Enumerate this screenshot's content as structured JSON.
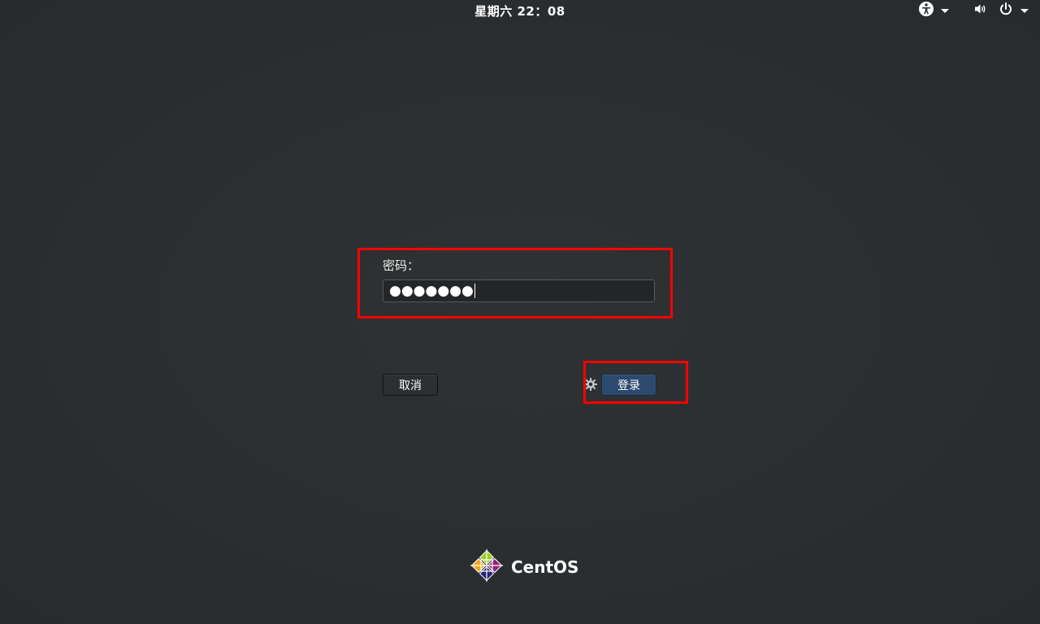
{
  "topbar": {
    "clock": "星期六  22：08",
    "accessibility_icon": "accessibility-icon",
    "volume_icon": "volume-icon",
    "power_icon": "power-icon"
  },
  "auth": {
    "prompt_label": "密码：",
    "password_mask": "●●●●●●●",
    "cancel_label": "取消",
    "login_label": "登录",
    "session_icon": "gear-icon"
  },
  "branding": {
    "logo_text": "CentOS",
    "logo_icon": "centos-logo-icon"
  },
  "colors": {
    "background": "#2b2e30",
    "login_button": "#2c4a6e",
    "highlight": "#ff0000"
  }
}
